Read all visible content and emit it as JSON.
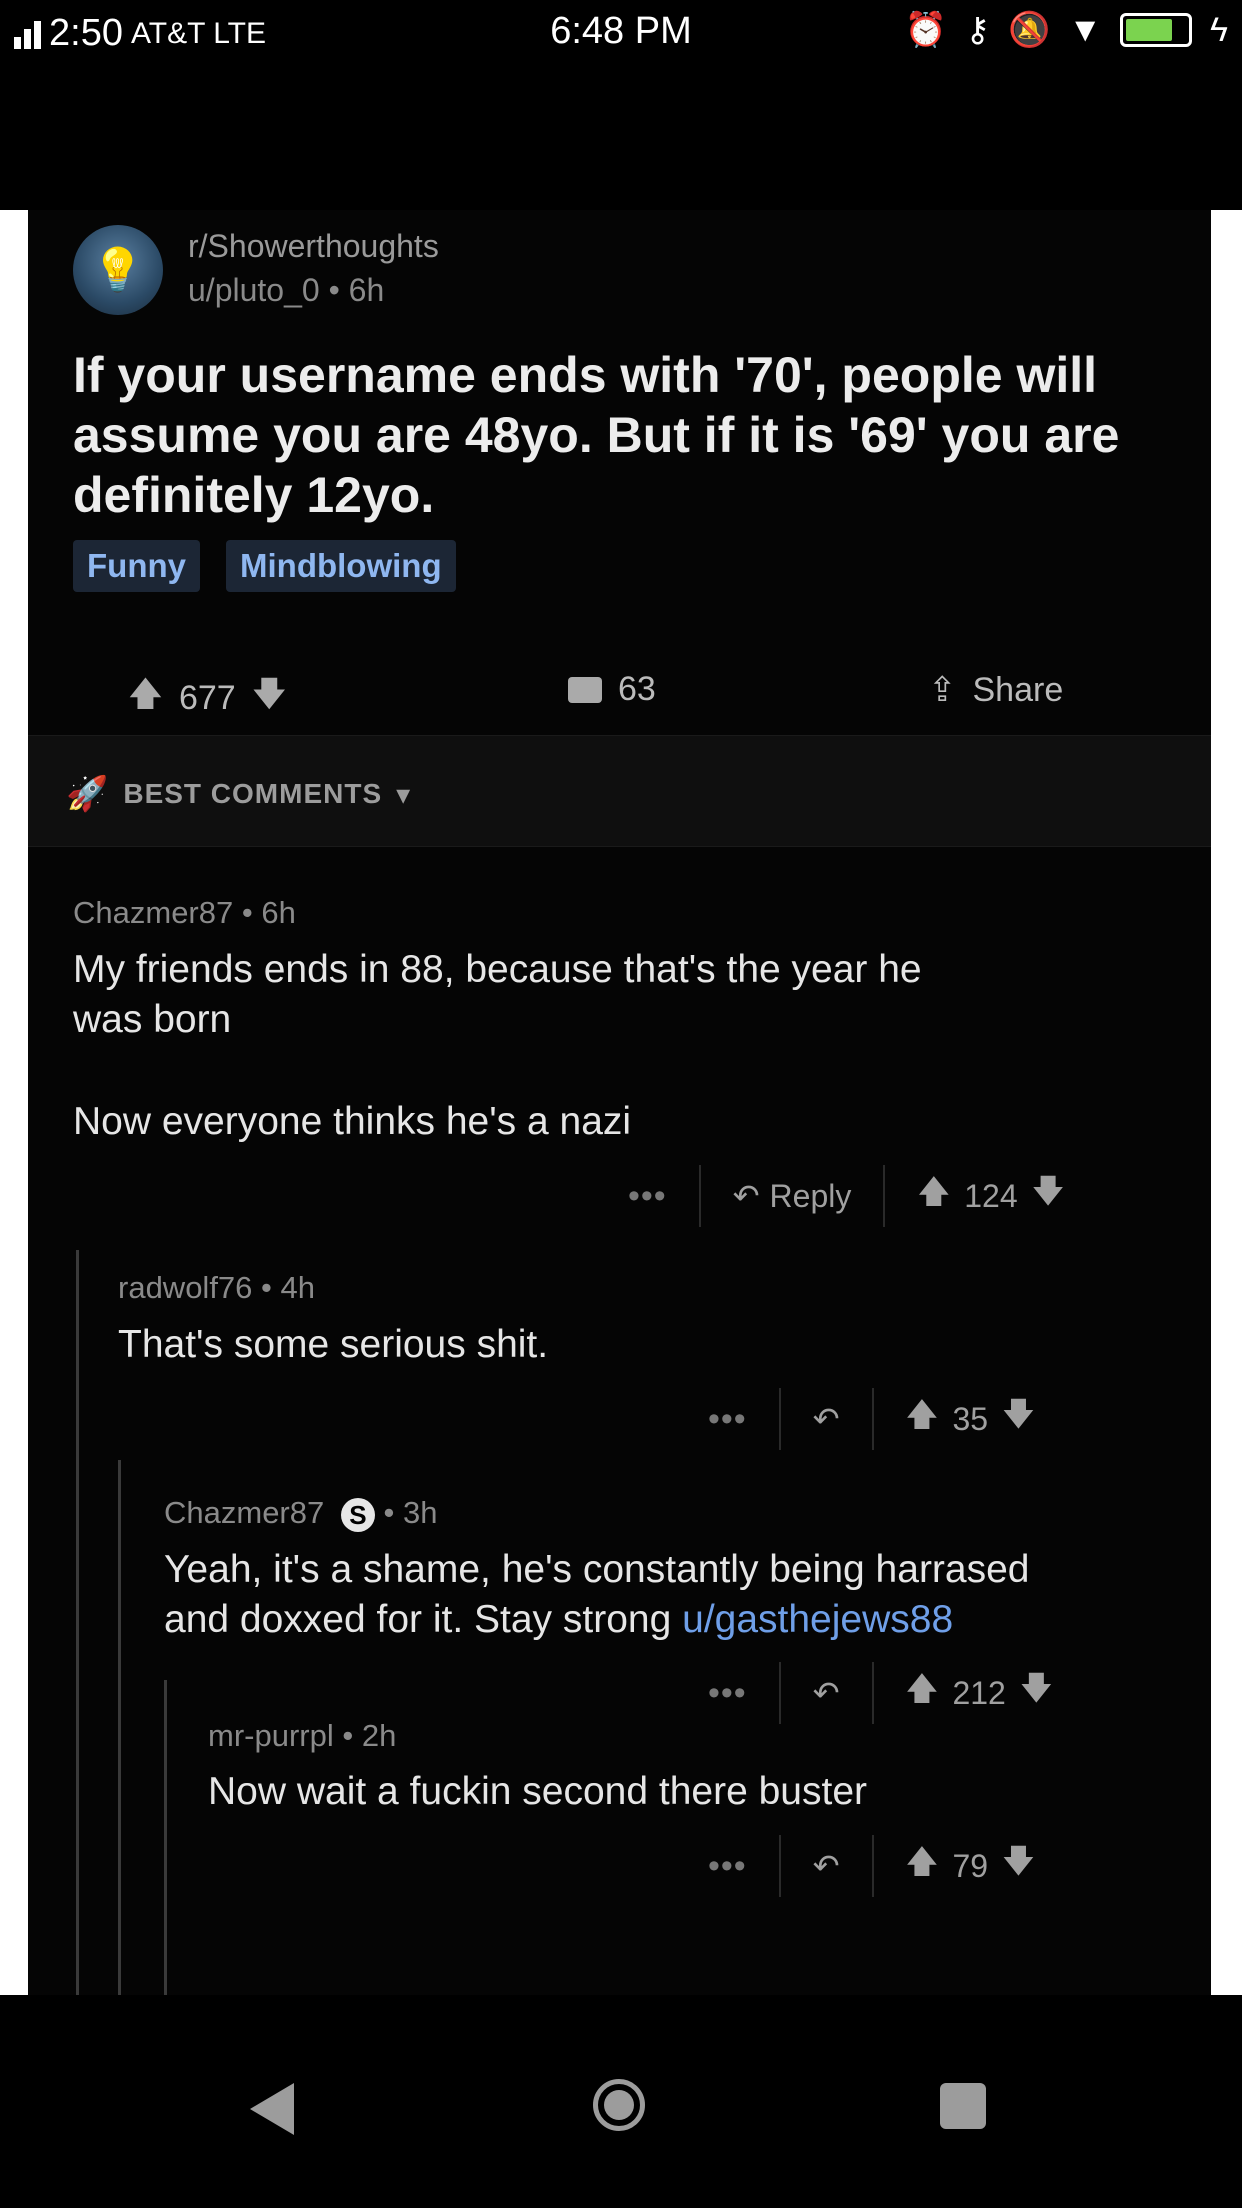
{
  "status_bar": {
    "left_text": "2:50",
    "carrier": "AT&T LTE",
    "time": "6:48 PM",
    "icons": [
      "alarm-icon",
      "key-icon",
      "bell-off-icon",
      "wifi-icon",
      "battery-icon",
      "charging-icon"
    ]
  },
  "post": {
    "subreddit": "r/Showerthoughts",
    "author": "u/pluto_0",
    "age": "6h",
    "title": "If your username ends with '70', people will assume you are 48yo. But if it is '69' you are definitely 12yo.",
    "flairs": [
      "Funny",
      "Mindblowing"
    ],
    "score": "677",
    "comments": "63",
    "share_label": "Share"
  },
  "sort": {
    "label": "BEST COMMENTS"
  },
  "comments": [
    {
      "author": "Chazmer87",
      "age": "6h",
      "text_lines": [
        "My friends ends in 88, because that's the year he",
        "was born"
      ],
      "text_extra": "Now everyone thinks he's a nazi",
      "reply_label": "Reply",
      "score": "124"
    },
    {
      "author": "radwolf76",
      "age": "4h",
      "text": "That's some serious shit.",
      "score": "35"
    },
    {
      "author": "Chazmer87",
      "age": "3h",
      "badge": "S",
      "text_line1": "Yeah, it's a shame, he's constantly being harrased",
      "text_line2_pre": "and doxxed for it.  Stay strong ",
      "text_line2_link": "u/gasthejews88",
      "score": "212"
    },
    {
      "author": "mr-purrpl",
      "age": "2h",
      "text": "Now wait a fuckin second there buster",
      "score": "79"
    }
  ],
  "colors": {
    "link": "#6f9fe8",
    "flair_text": "#8fb7f0",
    "background": "#050505"
  }
}
